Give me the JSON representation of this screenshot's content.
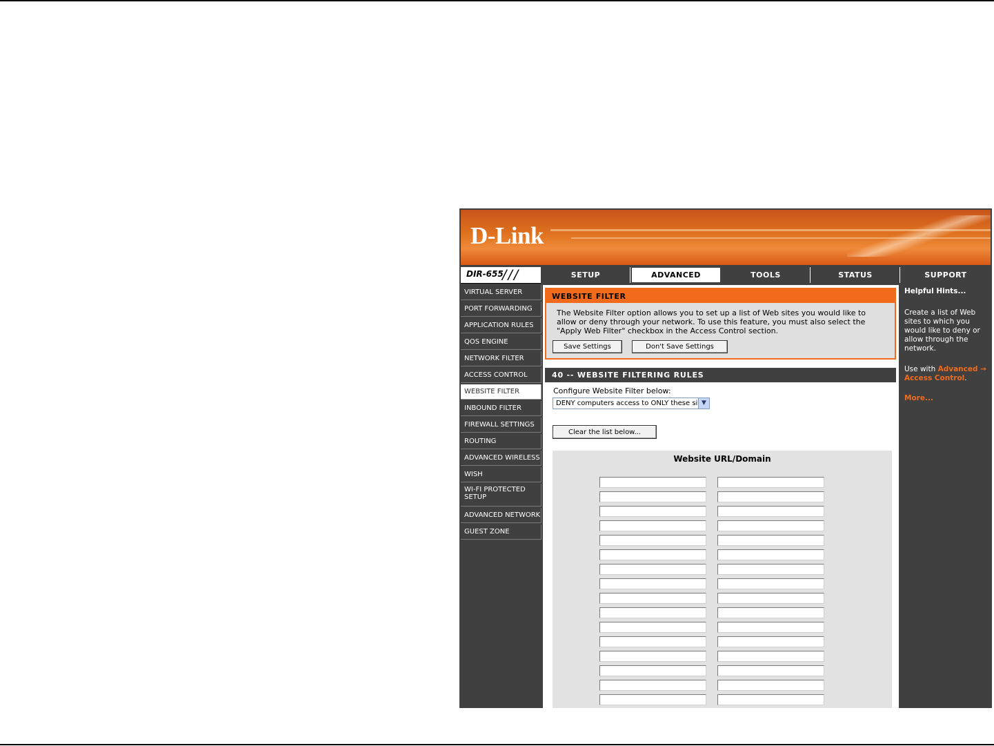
{
  "brand": {
    "logo": "D-Link",
    "model": "DIR-655"
  },
  "tabs": [
    {
      "label": "SETUP"
    },
    {
      "label": "ADVANCED"
    },
    {
      "label": "TOOLS"
    },
    {
      "label": "STATUS"
    },
    {
      "label": "SUPPORT"
    }
  ],
  "active_tab": "ADVANCED",
  "sidebar": {
    "items": [
      {
        "label": "VIRTUAL SERVER"
      },
      {
        "label": "PORT FORWARDING"
      },
      {
        "label": "APPLICATION RULES"
      },
      {
        "label": "QOS ENGINE"
      },
      {
        "label": "NETWORK FILTER"
      },
      {
        "label": "ACCESS CONTROL"
      },
      {
        "label": "WEBSITE FILTER"
      },
      {
        "label": "INBOUND FILTER"
      },
      {
        "label": "FIREWALL SETTINGS"
      },
      {
        "label": "ROUTING"
      },
      {
        "label": "ADVANCED WIRELESS"
      },
      {
        "label": "WISH"
      },
      {
        "label": "WI-FI PROTECTED SETUP"
      },
      {
        "label": "ADVANCED NETWORK"
      },
      {
        "label": "GUEST ZONE"
      }
    ],
    "active": "WEBSITE FILTER"
  },
  "filter_box": {
    "title": "WEBSITE FILTER",
    "description": "The Website Filter option allows you to set up a list of Web sites you would like to allow or deny through your network. To use this feature, you must also select the \"Apply Web Filter\" checkbox in the Access Control section.",
    "save_label": "Save Settings",
    "dont_save_label": "Don't Save Settings"
  },
  "rules": {
    "title": "40 -- WEBSITE FILTERING RULES",
    "config_label": "Configure Website Filter below:",
    "select_value": "DENY computers access to ONLY these sites",
    "clear_label": "Clear the list below...",
    "column_title": "Website URL/Domain",
    "visible_rows": 16
  },
  "hints": {
    "title": "Helpful Hints...",
    "text": "Create a list of Web sites to which you would like to deny or allow through the network.",
    "use_prefix": "Use with ",
    "use_link": "Advanced → Access Control",
    "use_suffix": ".",
    "more": "More..."
  },
  "colors": {
    "accent": "#f26a1b",
    "dark": "#404040",
    "panel": "#dfdfdf"
  }
}
